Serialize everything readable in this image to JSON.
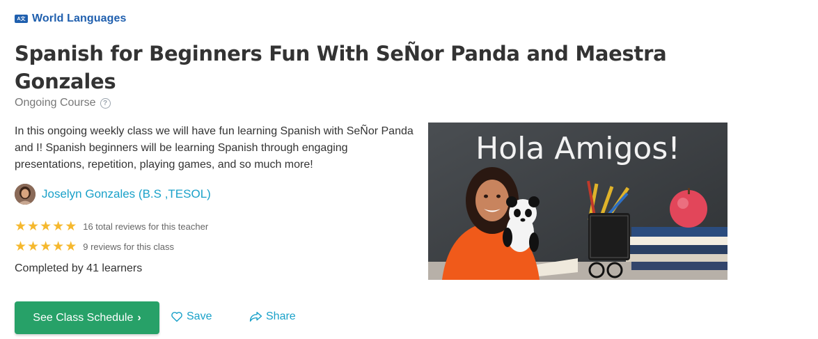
{
  "category": {
    "icon": "language-icon",
    "icon_text": "A文",
    "label": "World Languages"
  },
  "title": "Spanish for Beginners Fun With SeÑor Panda and Maestra Gonzales",
  "course_type": "Ongoing Course",
  "description": "In this ongoing weekly class we will have fun learning Spanish with SeÑor Panda and I! Spanish beginners will be learning Spanish through engaging presentations, repetition, playing games, and so much more!",
  "teacher": {
    "name": "Joselyn Gonzales (B.S ,TESOL)"
  },
  "reviews": [
    {
      "rating": 5,
      "text": "16 total reviews for this teacher"
    },
    {
      "rating": 5,
      "text": "9 reviews for this class"
    }
  ],
  "completed": "Completed by 41 learners",
  "actions": {
    "primary_label": "See Class Schedule",
    "save_label": "Save",
    "share_label": "Share"
  },
  "hero": {
    "chalkboard_text": "Hola Amigos!"
  },
  "colors": {
    "brand_blue": "#1f5fae",
    "link_teal": "#1aa1c9",
    "button_green": "#27a168",
    "star_gold": "#f5b82e"
  }
}
